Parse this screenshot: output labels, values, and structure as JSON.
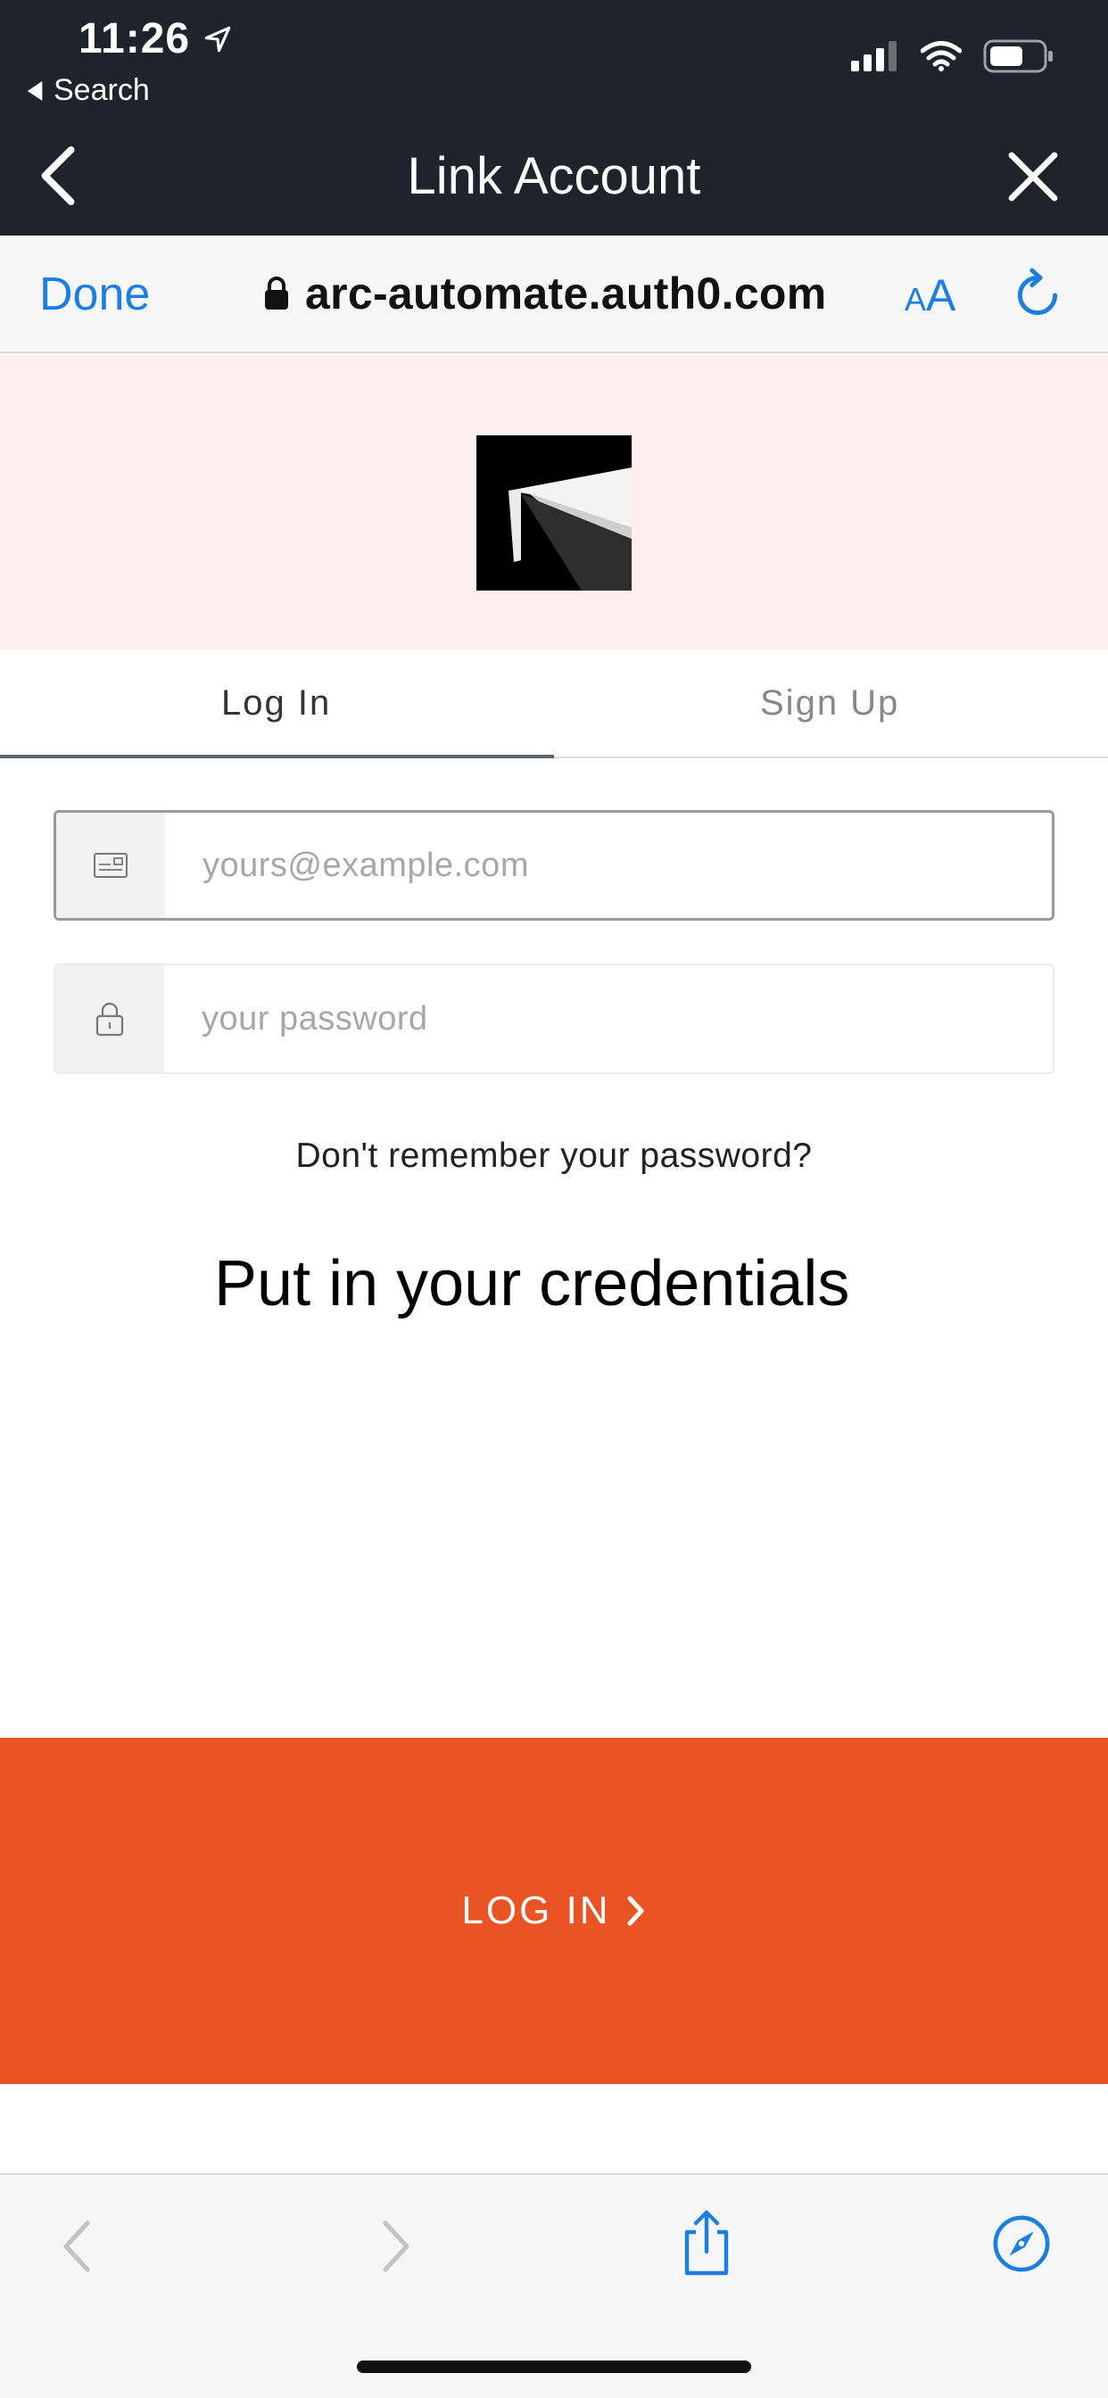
{
  "status_bar": {
    "time": "11:26",
    "back_label": "Search"
  },
  "nav": {
    "title": "Link Account"
  },
  "safari": {
    "done_label": "Done",
    "url": "arc-automate.auth0.com",
    "text_size_label_small": "A",
    "text_size_label_large": "A"
  },
  "tabs": {
    "login_label": "Log In",
    "signup_label": "Sign Up"
  },
  "form": {
    "email_placeholder": "yours@example.com",
    "password_placeholder": "your password",
    "forgot_label": "Don't remember your password?",
    "message": "Put in your credentials",
    "login_button_label": "LOG IN"
  },
  "colors": {
    "accent": "#ea5323",
    "link": "#1d7ee0",
    "header_dark": "#1f232b",
    "banner_bg": "#fff0ef"
  }
}
